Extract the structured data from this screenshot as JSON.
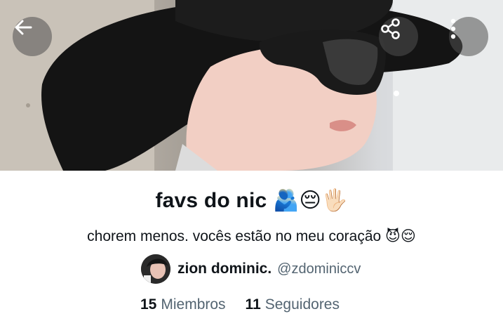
{
  "banner": {
    "image_alt": "person wearing black hat and dark sunglasses"
  },
  "top_bar": {
    "back_icon": "arrow-left-icon",
    "share_icon": "share-icon",
    "more_icon": "more-vertical-icon"
  },
  "list": {
    "title": "favs do nic",
    "title_emojis": "🫂😔🖐🏻",
    "description": "chorem menos. vocês estão no meu coração",
    "description_emojis": "😈😌"
  },
  "owner": {
    "name": "zion dominic.",
    "handle": "@zdominiccv"
  },
  "stats": {
    "members_count": "15",
    "members_label": "Miembros",
    "followers_count": "11",
    "followers_label": "Seguidores"
  },
  "colors": {
    "text_primary": "#0f1419",
    "text_secondary": "#536471",
    "button_overlay": "#505050"
  }
}
